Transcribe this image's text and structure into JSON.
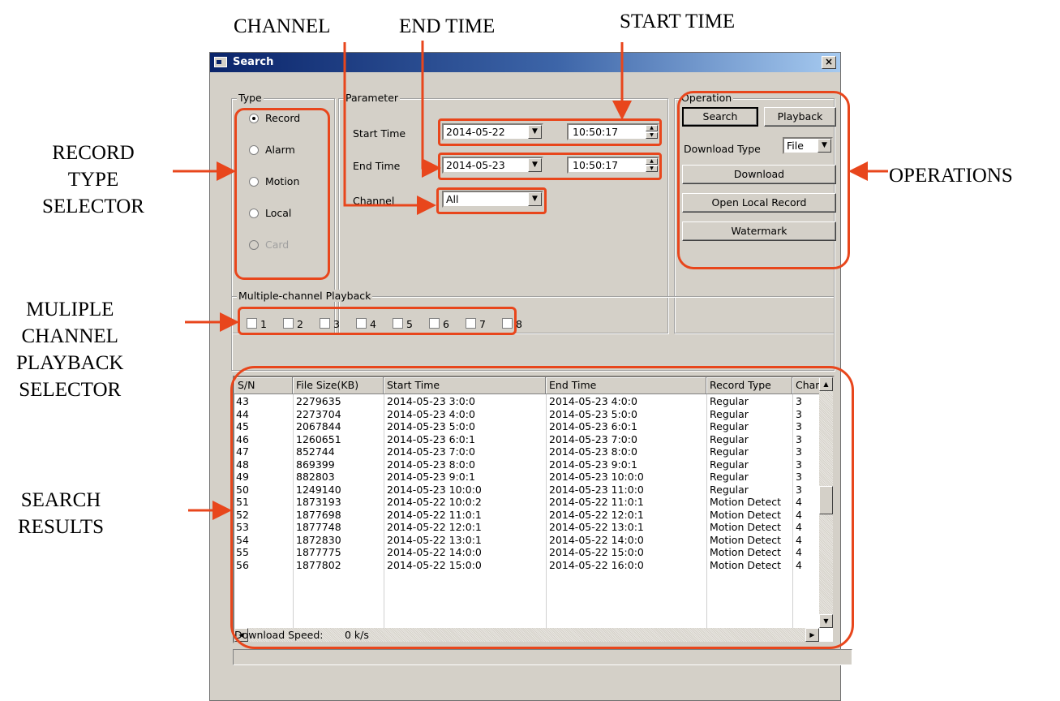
{
  "annotations": {
    "channel": "CHANNEL",
    "end_time": "END TIME",
    "start_time": "START TIME",
    "record_type": [
      "RECORD",
      "TYPE",
      "SELECTOR"
    ],
    "operations": "OPERATIONS",
    "multiple": [
      "MULIPLE",
      "CHANNEL",
      "PLAYBACK",
      "SELECTOR"
    ],
    "search_results": [
      "SEARCH",
      "RESULTS"
    ]
  },
  "window": {
    "title": "Search",
    "close_label": "×"
  },
  "type_group": {
    "title": "Type",
    "options": [
      {
        "label": "Record",
        "checked": true,
        "disabled": false
      },
      {
        "label": "Alarm",
        "checked": false,
        "disabled": false
      },
      {
        "label": "Motion",
        "checked": false,
        "disabled": false
      },
      {
        "label": "Local",
        "checked": false,
        "disabled": false
      },
      {
        "label": "Card",
        "checked": false,
        "disabled": true
      }
    ]
  },
  "parameter_group": {
    "title": "Parameter",
    "start_time_label": "Start Time",
    "start_date": "2014-05-22",
    "start_clock": "10:50:17",
    "end_time_label": "End Time",
    "end_date": "2014-05-23",
    "end_clock": "10:50:17",
    "channel_label": "Channel",
    "channel_value": "All"
  },
  "operation_group": {
    "title": "Operation",
    "search_label": "Search",
    "playback_label": "Playback",
    "download_type_label": "Download Type",
    "download_type_value": "File",
    "download_label": "Download",
    "open_local_label": "Open Local Record",
    "watermark_label": "Watermark"
  },
  "multi_group": {
    "title": "Multiple-channel Playback",
    "channels": [
      "1",
      "2",
      "3",
      "4",
      "5",
      "6",
      "7",
      "8"
    ]
  },
  "results": {
    "columns": [
      "S/N",
      "File Size(KB)",
      "Start Time",
      "End Time",
      "Record Type",
      "Chan."
    ],
    "rows": [
      [
        "43",
        "2279635",
        "2014-05-23 3:0:0",
        "2014-05-23 4:0:0",
        "Regular",
        "3"
      ],
      [
        "44",
        "2273704",
        "2014-05-23 4:0:0",
        "2014-05-23 5:0:0",
        "Regular",
        "3"
      ],
      [
        "45",
        "2067844",
        "2014-05-23 5:0:0",
        "2014-05-23 6:0:1",
        "Regular",
        "3"
      ],
      [
        "46",
        "1260651",
        "2014-05-23 6:0:1",
        "2014-05-23 7:0:0",
        "Regular",
        "3"
      ],
      [
        "47",
        "852744",
        "2014-05-23 7:0:0",
        "2014-05-23 8:0:0",
        "Regular",
        "3"
      ],
      [
        "48",
        "869399",
        "2014-05-23 8:0:0",
        "2014-05-23 9:0:1",
        "Regular",
        "3"
      ],
      [
        "49",
        "882803",
        "2014-05-23 9:0:1",
        "2014-05-23 10:0:0",
        "Regular",
        "3"
      ],
      [
        "50",
        "1249140",
        "2014-05-23 10:0:0",
        "2014-05-23 11:0:0",
        "Regular",
        "3"
      ],
      [
        "51",
        "1873193",
        "2014-05-22 10:0:2",
        "2014-05-22 11:0:1",
        "Motion Detect",
        "4"
      ],
      [
        "52",
        "1877698",
        "2014-05-22 11:0:1",
        "2014-05-22 12:0:1",
        "Motion Detect",
        "4"
      ],
      [
        "53",
        "1877748",
        "2014-05-22 12:0:1",
        "2014-05-22 13:0:1",
        "Motion Detect",
        "4"
      ],
      [
        "54",
        "1872830",
        "2014-05-22 13:0:1",
        "2014-05-22 14:0:0",
        "Motion Detect",
        "4"
      ],
      [
        "55",
        "1877775",
        "2014-05-22 14:0:0",
        "2014-05-22 15:0:0",
        "Motion Detect",
        "4"
      ],
      [
        "56",
        "1877802",
        "2014-05-22 15:0:0",
        "2014-05-22 16:0:0",
        "Motion Detect",
        "4"
      ]
    ]
  },
  "status": {
    "download_speed_label": "Download Speed:",
    "download_speed_value": "0 k/s"
  },
  "colors": {
    "highlight": "#e8461c",
    "titlebar": "#0a246a",
    "window_bg": "#d4d0c8"
  }
}
